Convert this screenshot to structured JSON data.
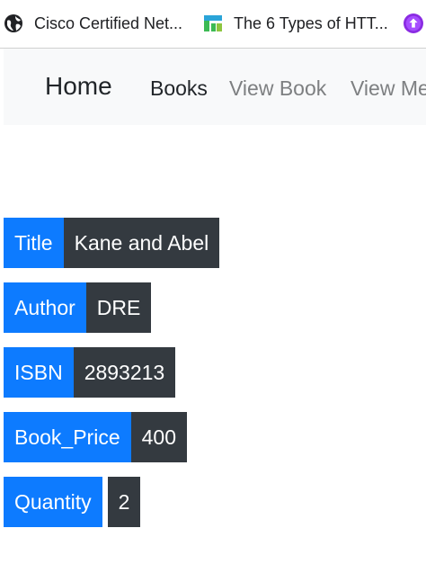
{
  "bookmarks": [
    {
      "label": "Cisco Certified Net...",
      "icon": "globe-icon"
    },
    {
      "label": "The 6 Types of HTT...",
      "icon": "site-favicon-icon"
    },
    {
      "label": "",
      "icon": "purple-upload-icon"
    }
  ],
  "navbar": {
    "brand": "Home",
    "links": [
      "Books",
      "View Book",
      "View Me"
    ]
  },
  "colors": {
    "label_bg": "#0d7bff",
    "value_bg": "#343a40",
    "navbar_bg": "#f8f9fa"
  },
  "book": {
    "fields": [
      {
        "label": "Title",
        "value": "Kane and Abel"
      },
      {
        "label": "Author",
        "value": "DRE"
      },
      {
        "label": "ISBN",
        "value": "2893213"
      },
      {
        "label": "Book_Price",
        "value": "400"
      },
      {
        "label": "Quantity",
        "value": "2"
      }
    ]
  }
}
